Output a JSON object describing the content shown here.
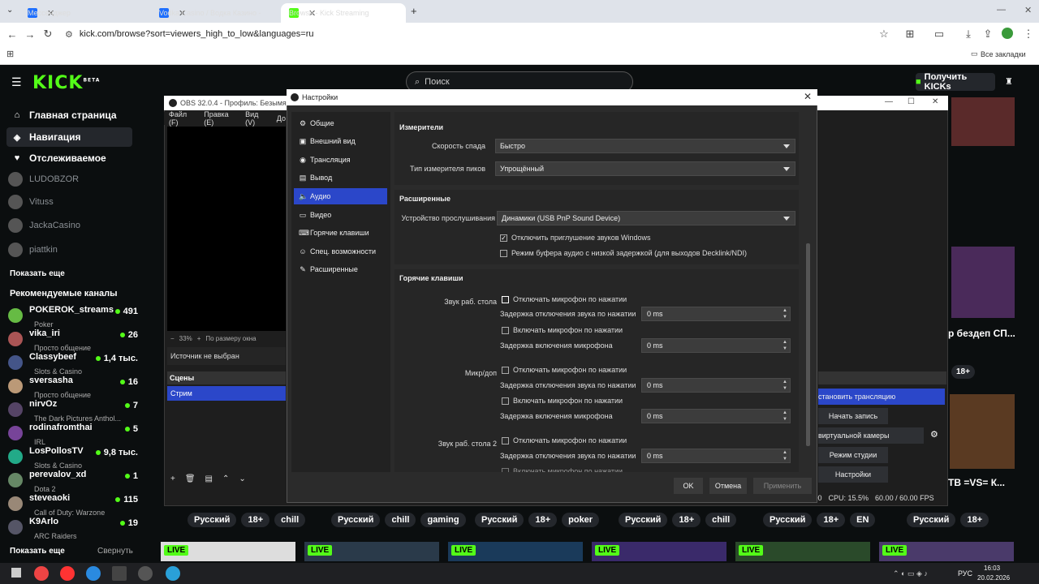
{
  "browser": {
    "tabs": [
      {
        "title": "Мессенджер"
      },
      {
        "title": "Vodka Casino / Водка Казино - "
      },
      {
        "title": "Browse - Kick Streaming"
      }
    ],
    "url": "kick.com/browse?sort=viewers_high_to_low&languages=ru",
    "bookmarks": "Все закладки"
  },
  "kick": {
    "logo": "KICK",
    "beta": "BETA",
    "search_placeholder": "Поиск",
    "get_kicks": "Получить KICKs",
    "nav": [
      {
        "label": "Главная страница",
        "icon": "home-icon"
      },
      {
        "label": "Навигация",
        "icon": "compass-icon"
      },
      {
        "label": "Отслеживаемое",
        "icon": "heart-icon"
      }
    ],
    "followed": [
      "LUDOBZOR",
      "Vituss",
      "JackaCasino",
      "piattkin"
    ],
    "show_more": "Показать еще",
    "recommended_title": "Рекомендуемые каналы",
    "recommended": [
      {
        "name": "POKEROK_streams",
        "category": "Poker",
        "viewers": "491"
      },
      {
        "name": "vika_iri",
        "category": "Просто общение",
        "viewers": "26"
      },
      {
        "name": "Classybeef",
        "category": "Slots & Casino",
        "viewers": "1,4 тыс."
      },
      {
        "name": "sversasha",
        "category": "Просто общение",
        "viewers": "16"
      },
      {
        "name": "nirvOz",
        "category": "The Dark Pictures Anthol...",
        "viewers": "7"
      },
      {
        "name": "rodinafromthai",
        "category": "IRL",
        "viewers": "5"
      },
      {
        "name": "LosPollosTV",
        "category": "Slots & Casino",
        "viewers": "9,8 тыс."
      },
      {
        "name": "perevalov_xd",
        "category": "Dota 2",
        "viewers": "1"
      },
      {
        "name": "steveaoki",
        "category": "Call of Duty: Warzone",
        "viewers": "115"
      },
      {
        "name": "K9Arlo",
        "category": "ARC Raiders",
        "viewers": "19"
      }
    ],
    "show_more2": "Показать еще",
    "collapse": "Свернуть",
    "tag_rows": [
      [
        "Русский",
        "18+",
        "chill"
      ],
      [
        "Русский",
        "chill",
        "gaming"
      ],
      [
        "Русский",
        "18+",
        "poker"
      ],
      [
        "Русский",
        "18+",
        "chill"
      ],
      [
        "Русский",
        "18+",
        "EN"
      ],
      [
        "Русский",
        "18+"
      ]
    ],
    "live": "LIVE",
    "right_titles": [
      "р бездеп СП...",
      "ТВ =VS= К..."
    ]
  },
  "obs": {
    "title": "OBS 32.0.4 - Профиль: Безымянный",
    "menu": [
      "Файл (F)",
      "Правка (E)",
      "Вид (V)",
      "До"
    ],
    "zoom": "33%",
    "fit": "По размеру окна",
    "no_source": "Источник не выбран",
    "scenes_header": "Сцены",
    "scene": "Стрим",
    "controls": [
      "становить трансляцию",
      "Начать запись",
      "виртуальной камеры",
      "Режим студии",
      "Настройки"
    ],
    "status": "CPU: 15.5%",
    "fps": "60.00 / 60.00 FPS",
    "status_prefix": ":00"
  },
  "settings": {
    "title": "Настройки",
    "categories": [
      {
        "label": "Общие",
        "icon": "gear-icon"
      },
      {
        "label": "Внешний вид",
        "icon": "palette-icon"
      },
      {
        "label": "Трансляция",
        "icon": "broadcast-icon"
      },
      {
        "label": "Вывод",
        "icon": "output-icon"
      },
      {
        "label": "Аудио",
        "icon": "speaker-icon"
      },
      {
        "label": "Видео",
        "icon": "monitor-icon"
      },
      {
        "label": "Горячие клавиши",
        "icon": "keyboard-icon"
      },
      {
        "label": "Спец. возможности",
        "icon": "accessibility-icon"
      },
      {
        "label": "Расширенные",
        "icon": "wrench-icon"
      }
    ],
    "meters": {
      "title": "Измерители",
      "decay_label": "Скорость спада",
      "decay_value": "Быстро",
      "peak_label": "Тип измерителя пиков",
      "peak_value": "Упрощённый"
    },
    "advanced": {
      "title": "Расширенные",
      "monitor_label": "Устройство прослушивания",
      "monitor_value": "Динамики (USB PnP Sound Device)",
      "ducking": "Отключить приглушение звуков Windows",
      "low_latency": "Режим буфера аудио с низкой задержкой (для выходов Decklink/NDI)"
    },
    "hotkeys": {
      "title": "Горячие клавиши",
      "sources": [
        {
          "name": "Звук раб. стола"
        },
        {
          "name": "Микр/доп"
        },
        {
          "name": "Звук раб. стола 2"
        }
      ],
      "mute_ptt": "Отключать микрофон по нажатии",
      "mute_delay": "Задержка отключения звука по нажатии",
      "talk_ptt": "Включать микрофон по нажатии",
      "talk_delay": "Задержка включения микрофона",
      "delay_value": "0 ms"
    },
    "ok": "OK",
    "cancel": "Отмена",
    "apply": "Применить"
  },
  "taskbar": {
    "lang": "РУС",
    "time": "16:03",
    "date": "20.02.2026"
  }
}
